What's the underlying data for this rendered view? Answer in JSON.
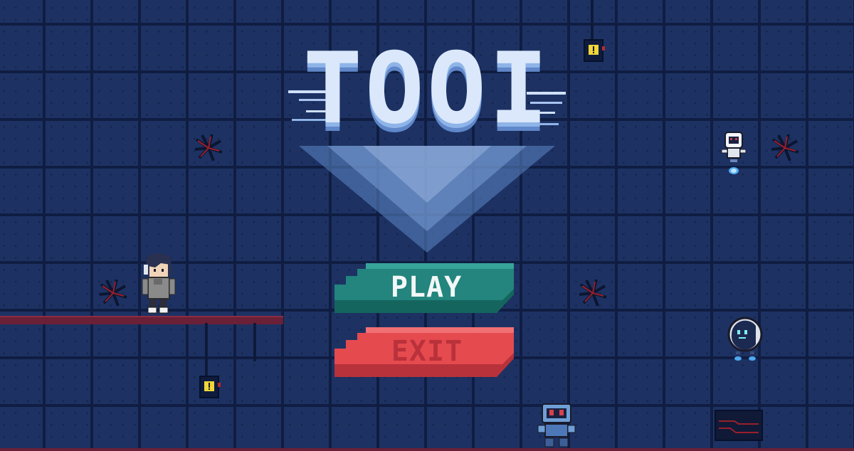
{
  "game": {
    "title": "TOOI",
    "menu": {
      "play_label": "PLAY",
      "exit_label": "EXIT"
    }
  },
  "colors": {
    "background": "#1d3263",
    "grid_line": "#101d42",
    "play_button": "#23857d",
    "exit_button": "#e54a4f",
    "platform": "#6a2036",
    "warning_sign": "#f0d63a"
  },
  "icons": {
    "warning_box": "warning-box-icon",
    "crack": "wall-crack-icon",
    "robot": "robot-icon"
  }
}
